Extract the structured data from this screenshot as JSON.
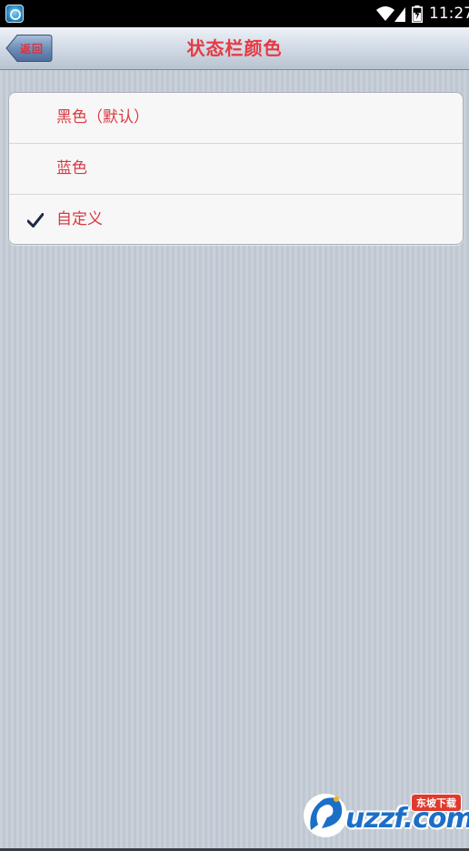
{
  "status_bar": {
    "time": "11:27",
    "icons": [
      "app-icon",
      "wifi-icon",
      "signal-icon",
      "battery-charging-icon"
    ]
  },
  "nav_bar": {
    "title": "状态栏颜色",
    "back_label": "返回"
  },
  "options": [
    {
      "label": "黑色（默认）",
      "selected": false
    },
    {
      "label": "蓝色",
      "selected": false
    },
    {
      "label": "自定义",
      "selected": true
    }
  ],
  "watermark": {
    "text": "uzzf.com",
    "badge": "东坡下载"
  },
  "colors": {
    "accent_text": "#d93a43",
    "check": "#1c2a44",
    "watermark_blue": "#1c6fc7"
  }
}
